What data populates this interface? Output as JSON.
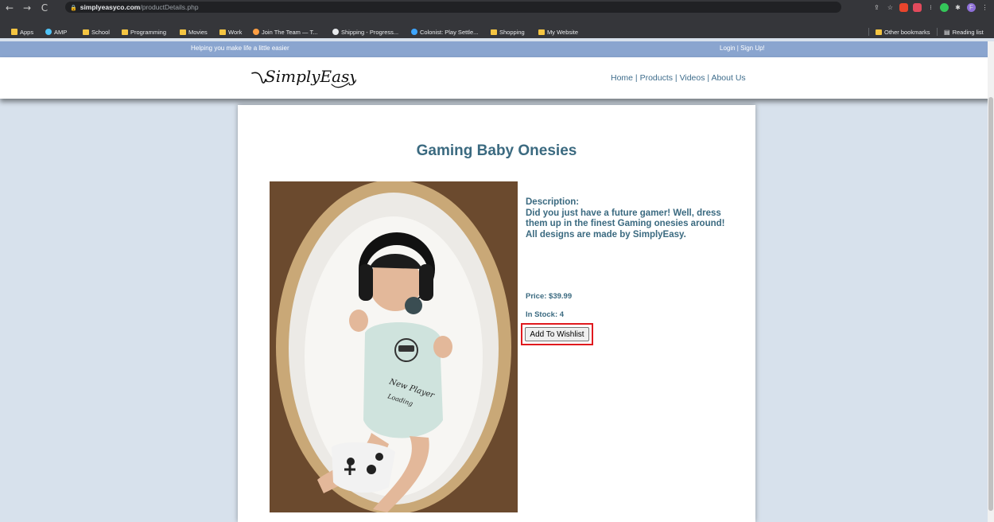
{
  "browser": {
    "url_host": "simplyeasyco.com",
    "url_path": "/productDetails.php",
    "bookmarks": [
      "Apps",
      "AMP",
      "School",
      "Programming",
      "Movies",
      "Work",
      "Join The Team — T...",
      "Shipping - Progress...",
      "Colonist: Play Settle...",
      "Shopping",
      "My Website"
    ],
    "other_bookmarks": "Other bookmarks",
    "reading_list": "Reading list"
  },
  "site": {
    "tagline": "Helping you make life a little easier",
    "auth_links": "Login | Sign Up!",
    "logo_text": "SimplyEasy",
    "nav": "Home | Products | Videos | About Us"
  },
  "product": {
    "title": "Gaming Baby Onesies",
    "description_label": "Description:",
    "description": "Did you just have a future gamer! Well, dress them up in the finest Gaming onesies around! All designs are made by SimplyEasy.",
    "price": "Price: $39.99",
    "stock": "In Stock: 4",
    "wishlist_button": "Add To Wishlist"
  },
  "colors": {
    "topbar": "#8aa5cf",
    "accent_text": "#3b6a80",
    "highlight": "#e0191e"
  }
}
